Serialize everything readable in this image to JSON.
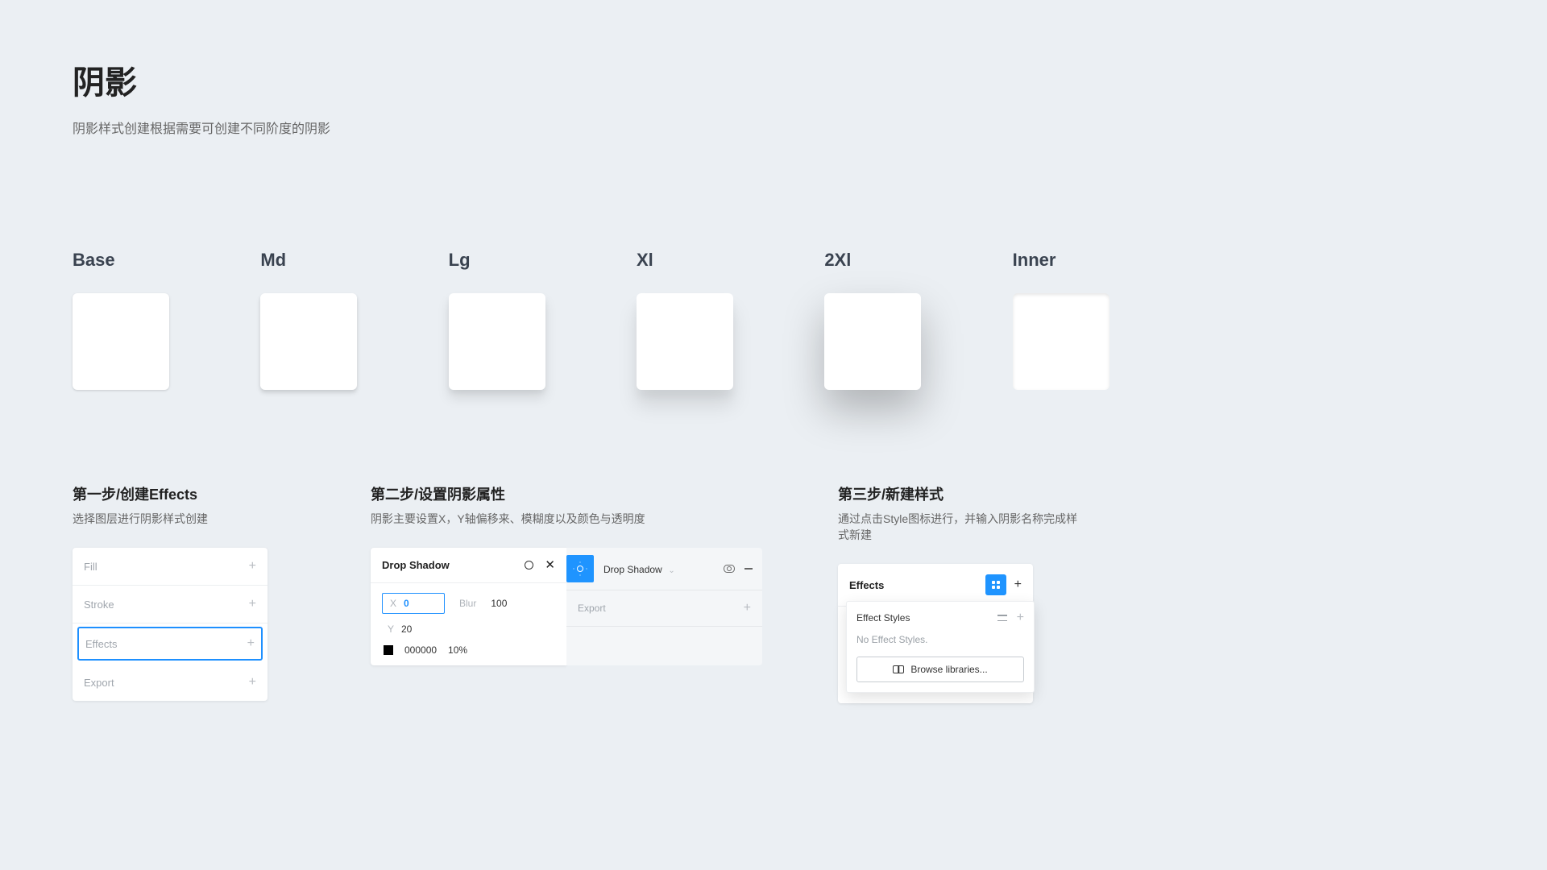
{
  "page": {
    "title": "阴影",
    "subtitle": "阴影样式创建根据需要可创建不同阶度的阴影"
  },
  "swatches": [
    {
      "label": "Base"
    },
    {
      "label": "Md"
    },
    {
      "label": "Lg"
    },
    {
      "label": "Xl"
    },
    {
      "label": "2Xl"
    },
    {
      "label": "Inner"
    }
  ],
  "steps": {
    "s1": {
      "title": "第一步/创建Effects",
      "subtitle": "选择图层进行阴影样式创建",
      "rows": {
        "fill": "Fill",
        "stroke": "Stroke",
        "effects": "Effects",
        "export": "Export"
      }
    },
    "s2": {
      "title": "第二步/设置阴影属性",
      "subtitle": "阴影主要设置X，Y轴偏移来、模糊度以及颜色与透明度",
      "left": {
        "header": "Drop Shadow",
        "x_label": "X",
        "x_value": "0",
        "blur_label": "Blur",
        "blur_value": "100",
        "y_label": "Y",
        "y_value": "20",
        "hex": "000000",
        "opacity": "10%"
      },
      "right": {
        "header": "Drop Shadow",
        "export": "Export"
      }
    },
    "s3": {
      "title": "第三步/新建样式",
      "subtitle": "通过点击Style图标进行，并输入阴影名称完成样式新建",
      "panel": {
        "header": "Effects",
        "drop_title": "Effect Styles",
        "empty": "No Effect Styles.",
        "browse": "Browse libraries..."
      }
    }
  }
}
